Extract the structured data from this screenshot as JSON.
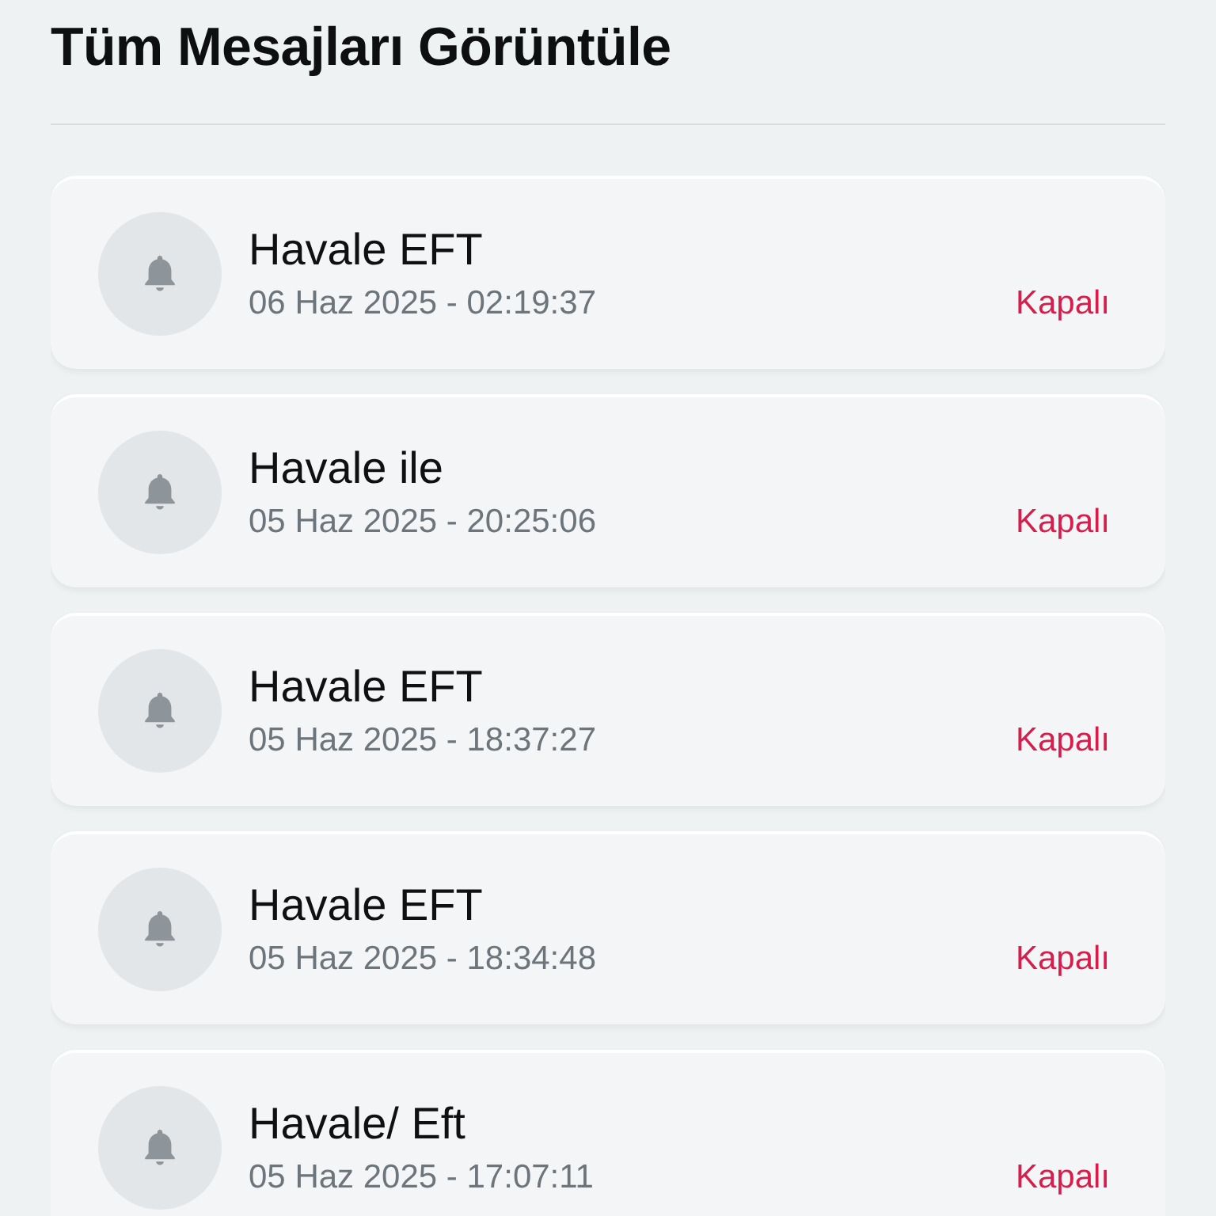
{
  "title": "Tüm Mesajları Görüntüle",
  "messages": [
    {
      "title": "Havale EFT",
      "date": "06 Haz 2025 - 02:19:37",
      "status": "Kapalı"
    },
    {
      "title": "Havale ile",
      "date": "05 Haz 2025 - 20:25:06",
      "status": "Kapalı"
    },
    {
      "title": "Havale EFT",
      "date": "05 Haz 2025 - 18:37:27",
      "status": "Kapalı"
    },
    {
      "title": "Havale EFT",
      "date": "05 Haz 2025 - 18:34:48",
      "status": "Kapalı"
    },
    {
      "title": "Havale/ Eft",
      "date": "05 Haz 2025 - 17:07:11",
      "status": "Kapalı"
    }
  ]
}
